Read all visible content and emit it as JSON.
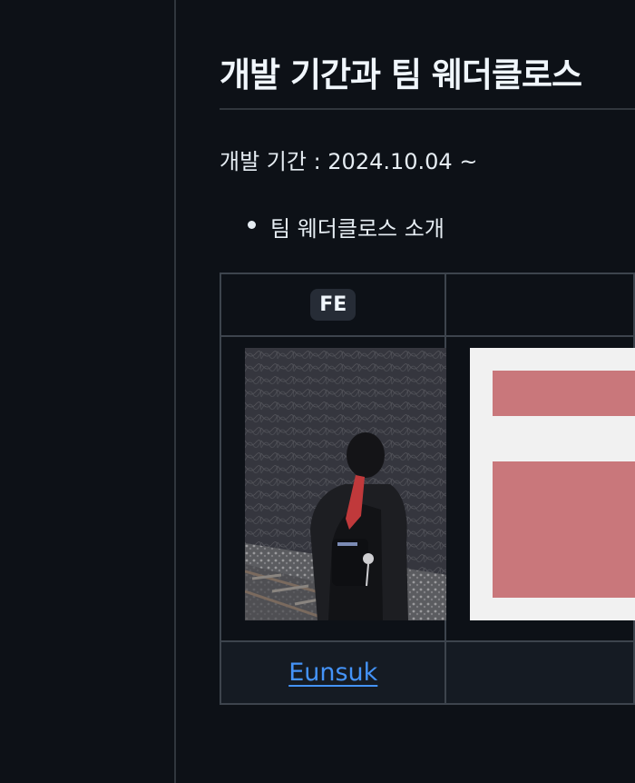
{
  "section": {
    "heading": "개발 기간과 팀 웨더클로스",
    "period_text": "개발 기간 : 2024.10.04 ~",
    "list_items": [
      "팀 웨더클로스 소개"
    ]
  },
  "team_table": {
    "headers": [
      "FE",
      ""
    ],
    "members": [
      {
        "name": "Eunsuk",
        "photo": "person-on-railway-photo"
      },
      {
        "name": "",
        "photo": "pixel-avatar-pink"
      }
    ]
  },
  "colors": {
    "background": "#0d1117",
    "border": "#30363d",
    "link": "#4493f8",
    "avatar_pink": "#c9777b"
  }
}
